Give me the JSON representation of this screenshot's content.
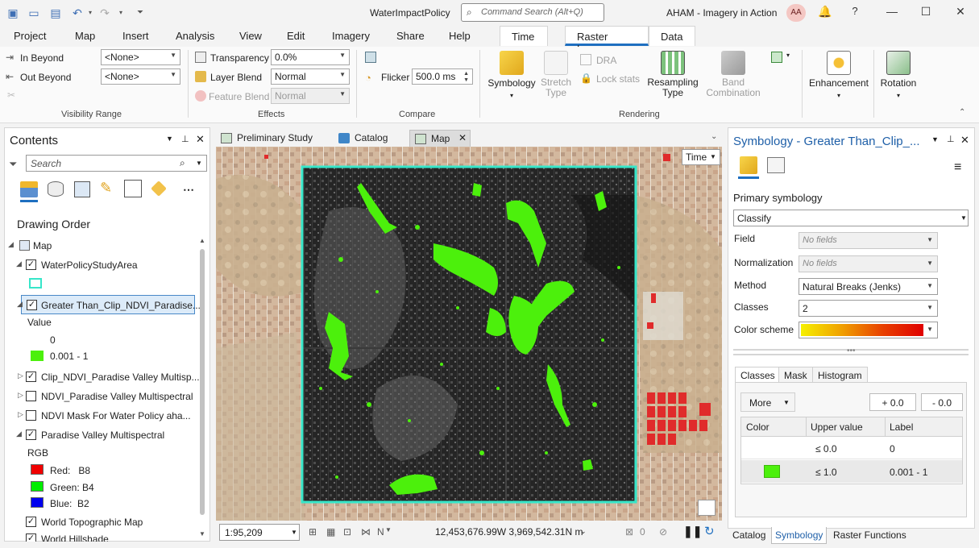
{
  "window": {
    "title": "WaterImpactPolicy",
    "search_placeholder": "Command Search (Alt+Q)",
    "project_title": "AHAM - Imagery in Action",
    "avatar_initials": "AA"
  },
  "ribbon_tabs": [
    "Project",
    "Map",
    "Insert",
    "Analysis",
    "View",
    "Edit",
    "Imagery",
    "Share",
    "Help",
    "Time",
    "Raster Layer",
    "Data"
  ],
  "ribbon": {
    "visibility": {
      "in_beyond": "In Beyond",
      "out_beyond": "Out Beyond",
      "in_value": "<None>",
      "out_value": "<None>",
      "group": "Visibility Range"
    },
    "effects": {
      "transparency": "Transparency",
      "transparency_value": "0.0%",
      "layer_blend": "Layer Blend",
      "layer_blend_value": "Normal",
      "feature_blend": "Feature Blend",
      "feature_blend_value": "Normal",
      "group": "Effects"
    },
    "compare": {
      "flicker": "Flicker",
      "flicker_value": "500.0  ms",
      "group": "Compare"
    },
    "rendering": {
      "symbology": "Symbology",
      "stretch_type": "Stretch Type",
      "dra": "DRA",
      "lock_stats": "Lock stats",
      "resampling_type": "Resampling Type",
      "band_combination": "Band Combination",
      "group": "Rendering"
    },
    "enhancement": "Enhancement",
    "rotation": "Rotation"
  },
  "contents": {
    "title": "Contents",
    "search_placeholder": "Search",
    "section": "Drawing Order",
    "map_label": "Map",
    "layers": {
      "water_policy": "WaterPolicyStudyArea",
      "greater_than": "Greater Than_Clip_NDVI_Paradise...",
      "value_heading": "Value",
      "value_0": "0",
      "value_1": "0.001 - 1",
      "clip_ndvi": "Clip_NDVI_Paradise Valley Multisp...",
      "ndvi_pv": "NDVI_Paradise Valley Multispectral",
      "ndvi_mask": "NDVI Mask For Water Policy aha...",
      "pv_multi": "Paradise Valley Multispectral",
      "rgb": "RGB",
      "red": "Red:   B8",
      "green": "Green: B4",
      "blue": "Blue:  B2",
      "world_topo": "World Topographic Map",
      "world_hill": "World Hillshade"
    }
  },
  "map_tabs": [
    "Preliminary Study",
    "Catalog",
    "Map"
  ],
  "map": {
    "time_button": "Time",
    "scale": "1:95,209",
    "coordinates": "12,453,676.99W 3,969,542.31N m",
    "selected_count": "0"
  },
  "symbology": {
    "title": "Symbology - Greater Than_Clip_...",
    "primary_heading": "Primary symbology",
    "primary_value": "Classify",
    "field_label": "Field",
    "field_value": "No fields",
    "normalization_label": "Normalization",
    "normalization_value": "No fields",
    "method_label": "Method",
    "method_value": "Natural Breaks (Jenks)",
    "classes_label": "Classes",
    "classes_value": "2",
    "color_scheme_label": "Color scheme",
    "subtabs": [
      "Classes",
      "Mask",
      "Histogram"
    ],
    "more_button": "More",
    "plus_button": "+ 0.0",
    "minus_button": "- 0.0",
    "table_headers": [
      "Color",
      "Upper value",
      "Label"
    ],
    "rows": [
      {
        "upper": "≤  0.0",
        "label": "0"
      },
      {
        "upper": "≤  1.0",
        "label": "0.001 - 1"
      }
    ]
  },
  "bottom_tabs": [
    "Catalog",
    "Symbology",
    "Raster Functions"
  ],
  "colors": {
    "accent": "#1e6fc0",
    "veg_green": "#4cf00c",
    "study_area": "#37e6c9"
  }
}
